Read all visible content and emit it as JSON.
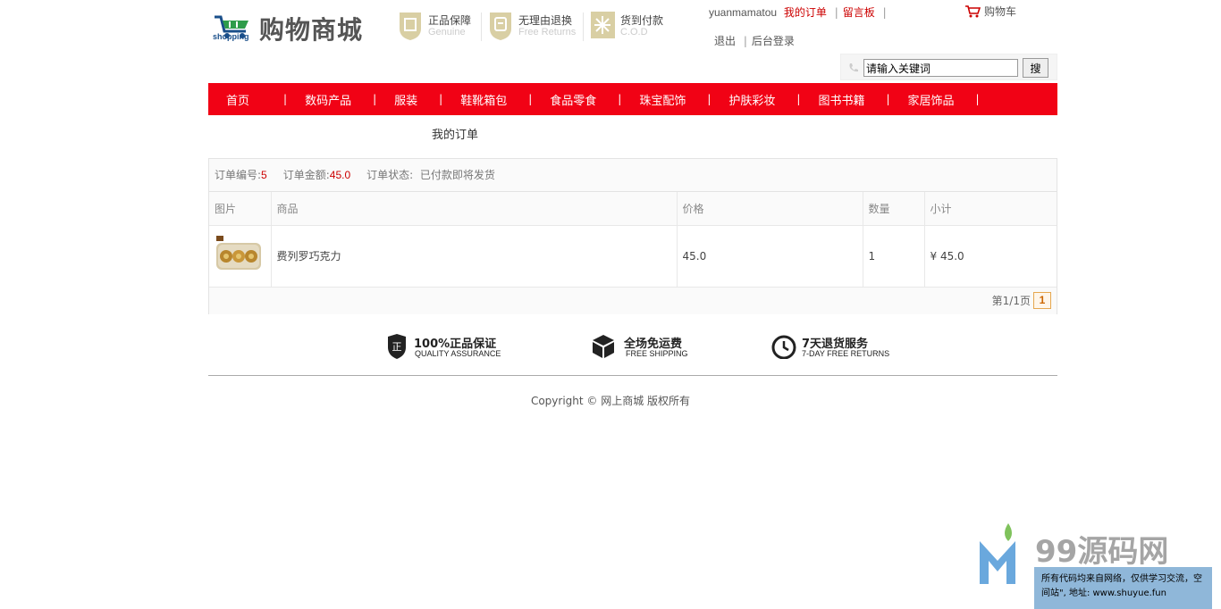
{
  "header": {
    "brand_sub": "shopping",
    "brand_name": "购物商城",
    "promos": [
      {
        "title": "正品保障",
        "subtitle": "Genuine"
      },
      {
        "title": "无理由退换",
        "subtitle": "Free Returns"
      },
      {
        "title": "货到付款",
        "subtitle": "C.O.D"
      }
    ],
    "user": {
      "username": "yuanmamatou",
      "my_orders": "我的订单",
      "message_board": "留言板",
      "logout": "退出",
      "admin_login": "后台登录"
    },
    "cart_label": "购物车",
    "search": {
      "value": "请输入关键词",
      "button": "搜"
    }
  },
  "nav": {
    "items": [
      "首页",
      "数码产品",
      "服装",
      "鞋靴箱包",
      "食品零食",
      "珠宝配饰",
      "护肤彩妆",
      "图书书籍",
      "家居饰品"
    ],
    "separator": "|"
  },
  "page_title": "我的订单",
  "order": {
    "number_label": "订单编号:",
    "number": "5",
    "amount_label": "订单金额:",
    "amount": "45.0",
    "status_label": "订单状态:",
    "status": "已付款即将发货",
    "columns": [
      "图片",
      "商品",
      "价格",
      "数量",
      "小计"
    ],
    "rows": [
      {
        "product": "费列罗巧克力",
        "price": "45.0",
        "qty": "1",
        "subtotal": "¥ 45.0"
      }
    ],
    "pager_text": "第1/1页",
    "current_page": "1"
  },
  "services": [
    {
      "icon": "shield-zheng-icon",
      "glyph": "正",
      "title": "100%正品保证",
      "subtitle": "QUALITY ASSURANCE"
    },
    {
      "icon": "package-icon",
      "title": "全场免运费",
      "subtitle": "FREE SHIPPING"
    },
    {
      "icon": "clock-icon",
      "title": "7天退货服务",
      "subtitle": "7-DAY FREE RETURNS"
    }
  ],
  "footer": {
    "copyright": "Copyright © 网上商城 版权所有"
  },
  "watermark": {
    "name": "99源码网",
    "note": "所有代码均来自网络，仅供学习交流，空间站\", 地址: www.shuyue.fun"
  },
  "colors": {
    "nav_bg": "#f10215",
    "accent_red": "#cc0000",
    "pager_border": "#e6a74f"
  }
}
